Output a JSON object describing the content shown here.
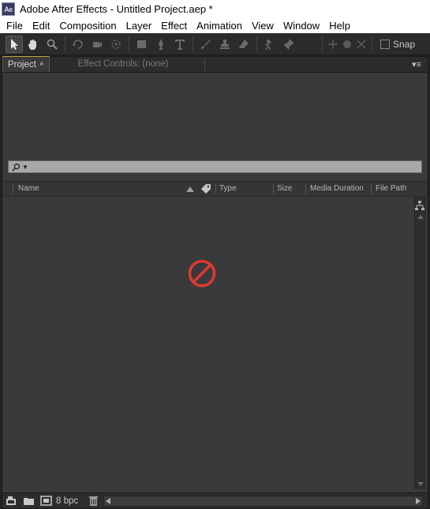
{
  "window": {
    "app_badge": "Ae",
    "title": "Adobe After Effects - Untitled Project.aep *"
  },
  "menu": {
    "items": [
      "File",
      "Edit",
      "Composition",
      "Layer",
      "Effect",
      "Animation",
      "View",
      "Window",
      "Help"
    ]
  },
  "toolbar": {
    "tools": [
      "selection-tool-icon",
      "hand-tool-icon",
      "zoom-tool-icon",
      "rotation-tool-icon",
      "orbit-camera-icon",
      "pan-behind-icon",
      "rectangle-tool-icon",
      "pen-tool-icon",
      "type-tool-icon",
      "brush-tool-icon",
      "clone-stamp-icon",
      "eraser-tool-icon",
      "roto-brush-icon",
      "puppet-pin-icon"
    ],
    "snap_label": "Snap"
  },
  "panel": {
    "tabs": [
      {
        "label": "Project",
        "active": true,
        "close": "×"
      },
      {
        "label": "Effect Controls: (none)",
        "active": false
      }
    ],
    "menu_glyph": "▾≡",
    "columns": [
      "Name",
      "Type",
      "Size",
      "Media Duration",
      "File Path"
    ],
    "footer": {
      "bit_depth": "8 bpc"
    }
  },
  "colors": {
    "panel_bg": "#3a393b",
    "toolbar_bg": "#2b2b2b",
    "active_tab_accent": "#c8a040",
    "no_symbol": "#e0392f"
  }
}
